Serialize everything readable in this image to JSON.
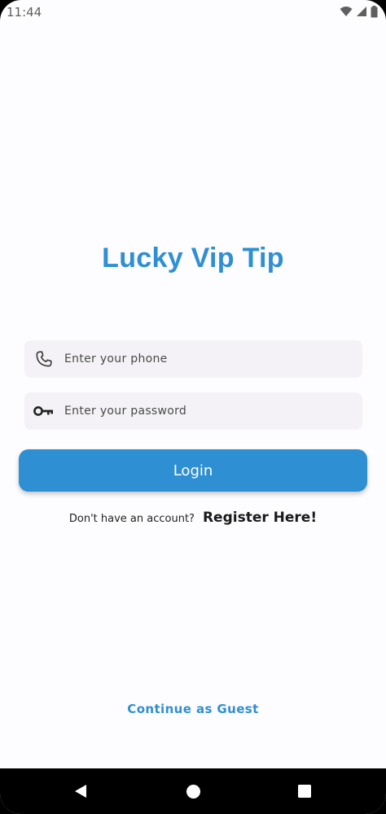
{
  "status_bar": {
    "time": "11:44",
    "icons": [
      "wifi-icon",
      "signal-icon",
      "battery-icon"
    ]
  },
  "app": {
    "title": "Lucky Vip Tip"
  },
  "form": {
    "phone_placeholder": "Enter your phone",
    "phone_value": "",
    "password_placeholder": "Enter your password",
    "password_value": "",
    "phone_icon": "phone-icon",
    "password_icon": "key-icon"
  },
  "actions": {
    "login_label": "Login",
    "register_prompt": "Don't have an account?",
    "register_label": "Register Here!",
    "guest_label": "Continue as Guest"
  },
  "nav": {
    "icons": [
      "back-icon",
      "home-icon",
      "recents-icon"
    ]
  },
  "colors": {
    "accent": "#2f8fd3",
    "field_bg": "#f4f2f6",
    "background": "#fdfcfe"
  }
}
